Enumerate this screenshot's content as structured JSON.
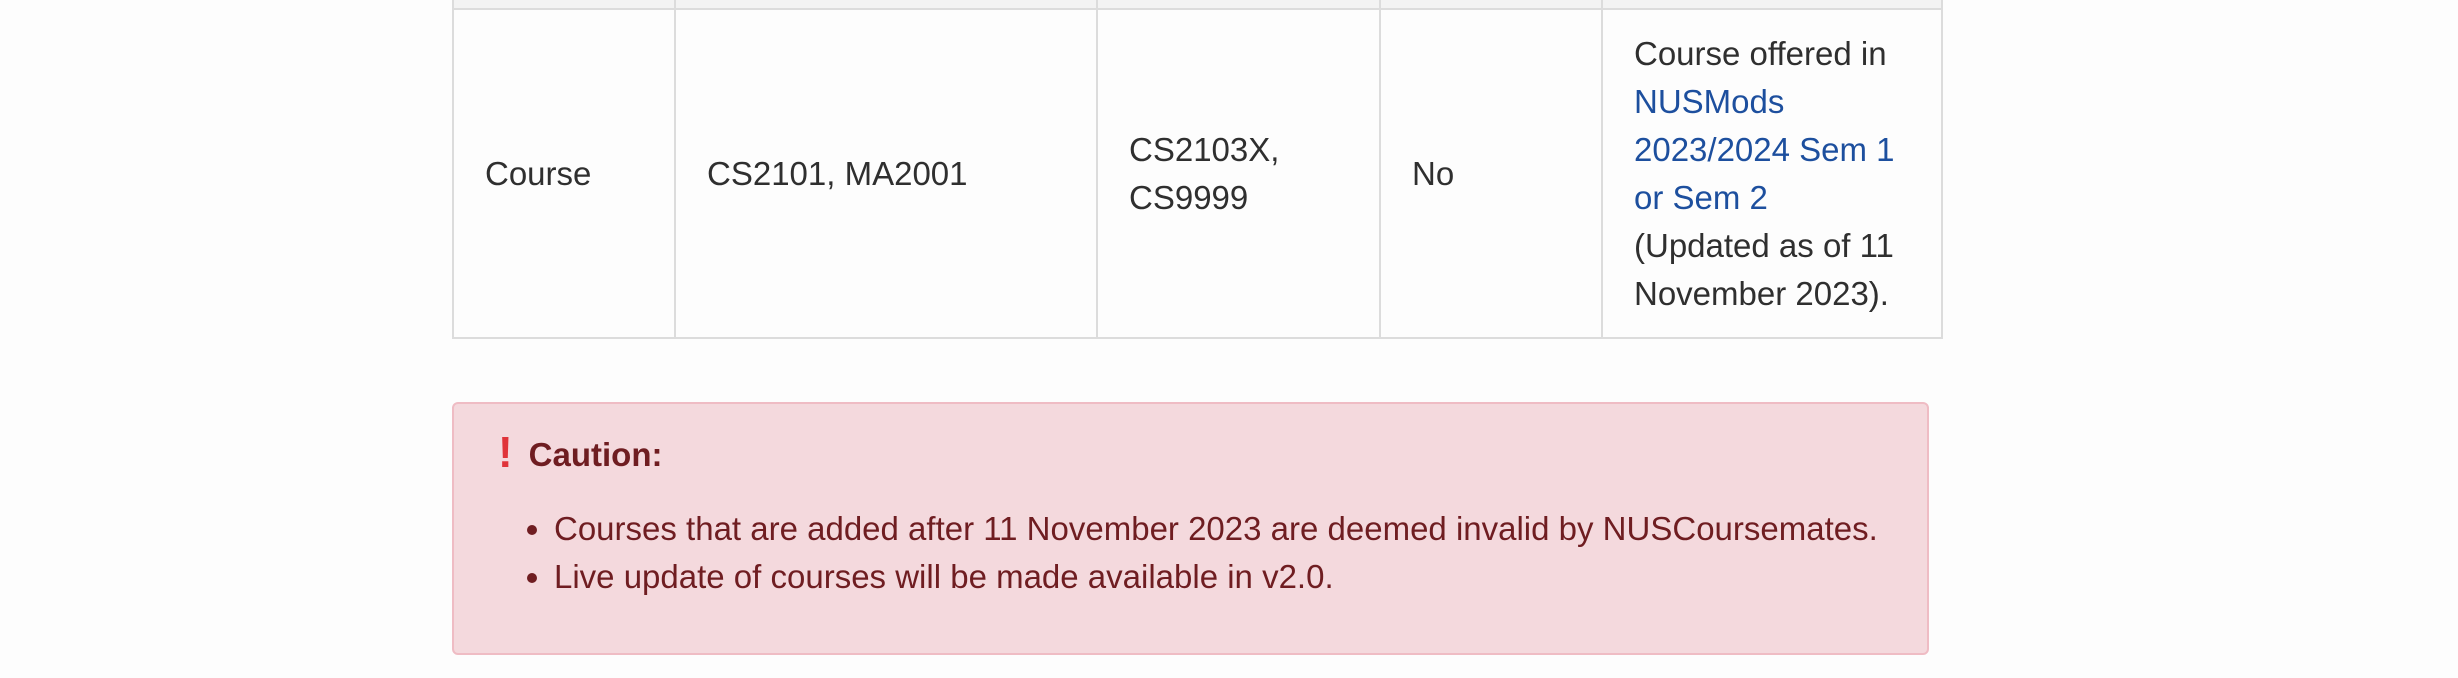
{
  "table": {
    "row": {
      "type": "Course",
      "prerequisites": "CS2101, MA2001",
      "equivalents_line1": "CS2103X,",
      "equivalents_line2": "CS9999",
      "flag": "No",
      "remarks": {
        "line1": "Course offered in",
        "link_line1": "NUSMods",
        "link_line2": "2023/2024 Sem 1",
        "link_line3": "or Sem 2",
        "line2": "(Updated as of 11",
        "line3": "November 2023)."
      }
    }
  },
  "caution": {
    "icon": "exclamation-icon",
    "title": "Caution:",
    "items": [
      "Courses that are added after 11 November 2023 are deemed invalid by NUSCoursemates.",
      "Live update of courses will be made available in v2.0."
    ]
  },
  "colors": {
    "link": "#1d4f9e",
    "caution_bg": "#f4d9dd",
    "caution_border": "#efbcc4",
    "caution_text": "#6f1d21",
    "caution_icon": "#e0343a"
  }
}
